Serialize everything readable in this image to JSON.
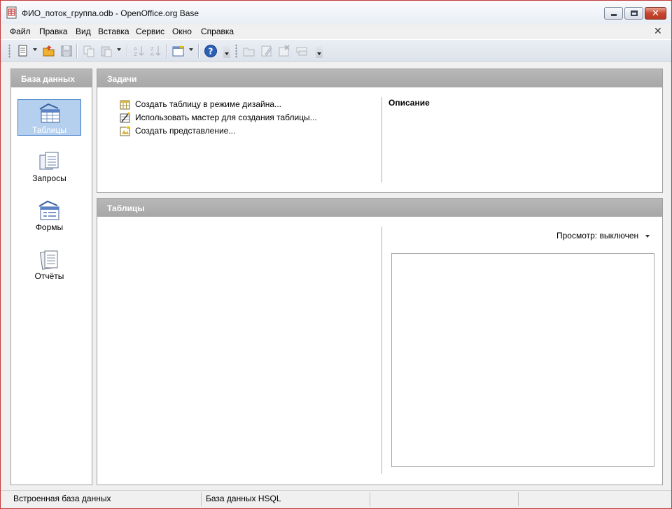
{
  "window": {
    "title": "ФИО_поток_группа.odb - OpenOffice.org Base"
  },
  "menu": {
    "items": [
      "Файл",
      "Правка",
      "Вид",
      "Вставка",
      "Сервис",
      "Окно",
      "Справка"
    ],
    "close_glyph": "✕"
  },
  "toolbar": {
    "buttons": [
      "new-document-icon",
      "open-folder-icon",
      "save-icon",
      "copy-icon",
      "paste-icon",
      "sort-ascending-icon",
      "sort-descending-icon",
      "form-icon",
      "help-icon",
      "open-db-object-icon",
      "edit-icon",
      "delete-icon",
      "rename-icon"
    ]
  },
  "sidebar": {
    "header": "База данных",
    "items": [
      {
        "label": "Таблицы",
        "icon": "tables-icon",
        "selected": true
      },
      {
        "label": "Запросы",
        "icon": "queries-icon",
        "selected": false
      },
      {
        "label": "Формы",
        "icon": "forms-icon",
        "selected": false
      },
      {
        "label": "Отчёты",
        "icon": "reports-icon",
        "selected": false
      }
    ]
  },
  "tasks": {
    "header": "Задачи",
    "items": [
      {
        "label": "Создать таблицу в режиме дизайна...",
        "icon": "design-table-icon"
      },
      {
        "label": "Использовать мастер для создания таблицы...",
        "icon": "table-wizard-icon"
      },
      {
        "label": "Создать представление...",
        "icon": "create-view-icon"
      }
    ],
    "description_title": "Описание"
  },
  "tables": {
    "header": "Таблицы",
    "preview_label": "Просмотр: выключен"
  },
  "status": {
    "cells": [
      "Встроенная база данных",
      "База данных HSQL",
      "",
      ""
    ]
  },
  "colors": {
    "panel_header": "#a9a9a9",
    "selected_bg": "#b5d0ef",
    "selected_border": "#3a78c6",
    "window_border": "#c23a3a"
  }
}
